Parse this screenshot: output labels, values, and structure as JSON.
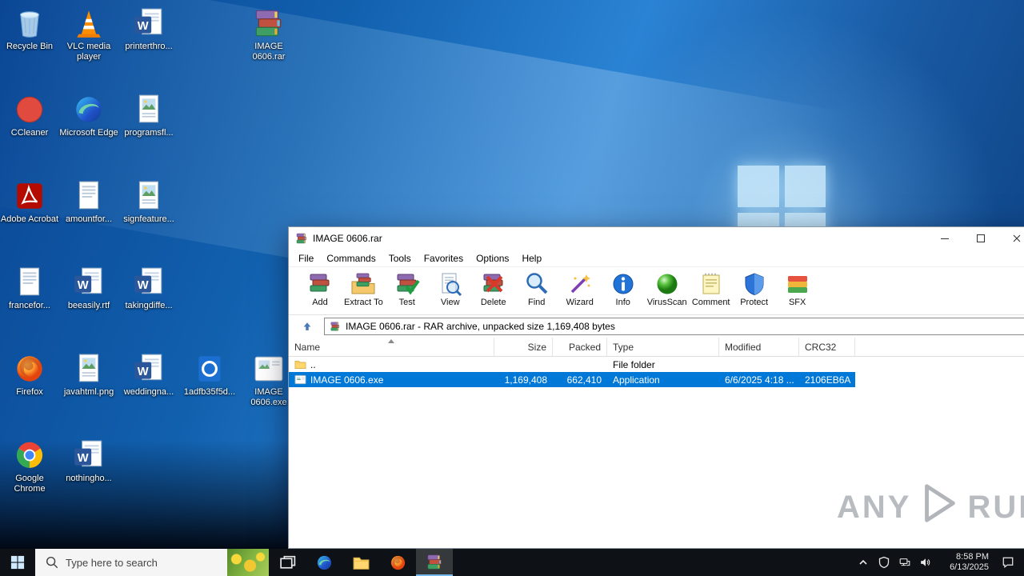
{
  "desktop": {
    "icons": [
      {
        "label": "Recycle Bin",
        "type": "recycle-bin",
        "col": 0,
        "row": 0
      },
      {
        "label": "VLC media player",
        "type": "vlc",
        "col": 1,
        "row": 0
      },
      {
        "label": "printerthro...",
        "type": "word",
        "col": 2,
        "row": 0
      },
      {
        "label": "IMAGE 0606.rar",
        "type": "winrar",
        "col": 4,
        "row": 0
      },
      {
        "label": "CCleaner",
        "type": "ccleaner",
        "col": 0,
        "row": 1
      },
      {
        "label": "Microsoft Edge",
        "type": "edge",
        "col": 1,
        "row": 1
      },
      {
        "label": "programsfl...",
        "type": "doc-image",
        "col": 2,
        "row": 1
      },
      {
        "label": "Adobe Acrobat",
        "type": "acrobat",
        "col": 0,
        "row": 2
      },
      {
        "label": "amountfor...",
        "type": "doc-plain",
        "col": 1,
        "row": 2
      },
      {
        "label": "signfeature...",
        "type": "doc-image",
        "col": 2,
        "row": 2
      },
      {
        "label": "francefor...",
        "type": "doc-plain",
        "col": 0,
        "row": 3
      },
      {
        "label": "beeasily.rtf",
        "type": "word",
        "col": 1,
        "row": 3
      },
      {
        "label": "takingdiffe...",
        "type": "word",
        "col": 2,
        "row": 3
      },
      {
        "label": "Firefox",
        "type": "firefox",
        "col": 0,
        "row": 4
      },
      {
        "label": "javahtml.png",
        "type": "doc-image",
        "col": 1,
        "row": 4
      },
      {
        "label": "weddingna...",
        "type": "word",
        "col": 2,
        "row": 4
      },
      {
        "label": "1adfb35f5d...",
        "type": "bluefile",
        "col": 3,
        "row": 4
      },
      {
        "label": "IMAGE 0606.exe",
        "type": "exe-image",
        "col": 4,
        "row": 4
      },
      {
        "label": "Google Chrome",
        "type": "chrome",
        "col": 0,
        "row": 5
      },
      {
        "label": "nothingho...",
        "type": "word",
        "col": 1,
        "row": 5
      }
    ]
  },
  "window": {
    "title": "IMAGE 0606.rar",
    "menu": [
      "File",
      "Commands",
      "Tools",
      "Favorites",
      "Options",
      "Help"
    ],
    "toolbar": [
      {
        "label": "Add",
        "icon": "add"
      },
      {
        "label": "Extract To",
        "icon": "extract"
      },
      {
        "label": "Test",
        "icon": "test"
      },
      {
        "label": "View",
        "icon": "view"
      },
      {
        "label": "Delete",
        "icon": "delete"
      },
      {
        "label": "Find",
        "icon": "find"
      },
      {
        "label": "Wizard",
        "icon": "wizard"
      },
      {
        "label": "Info",
        "icon": "info"
      },
      {
        "label": "VirusScan",
        "icon": "virusscan"
      },
      {
        "label": "Comment",
        "icon": "comment"
      },
      {
        "label": "Protect",
        "icon": "protect"
      },
      {
        "label": "SFX",
        "icon": "sfx"
      }
    ],
    "address": "IMAGE 0606.rar - RAR archive, unpacked size 1,169,408 bytes",
    "columns": [
      {
        "label": "Name"
      },
      {
        "label": "Size"
      },
      {
        "label": "Packed"
      },
      {
        "label": "Type"
      },
      {
        "label": "Modified"
      },
      {
        "label": "CRC32"
      }
    ],
    "rows": [
      {
        "name": "..",
        "size": "",
        "packed": "",
        "type": "File folder",
        "modified": "",
        "crc32": "",
        "icon": "folder",
        "selected": false
      },
      {
        "name": "IMAGE 0606.exe",
        "size": "1,169,408",
        "packed": "662,410",
        "type": "Application",
        "modified": "6/6/2025 4:18 ...",
        "crc32": "2106EB6A",
        "icon": "exe-small",
        "selected": true
      }
    ],
    "selection_color": "#0078d7"
  },
  "taskbar": {
    "search_placeholder": "Type here to search",
    "time": "8:58 PM",
    "date": "6/13/2025"
  },
  "watermark": {
    "left": "ANY",
    "right": "RUN"
  }
}
